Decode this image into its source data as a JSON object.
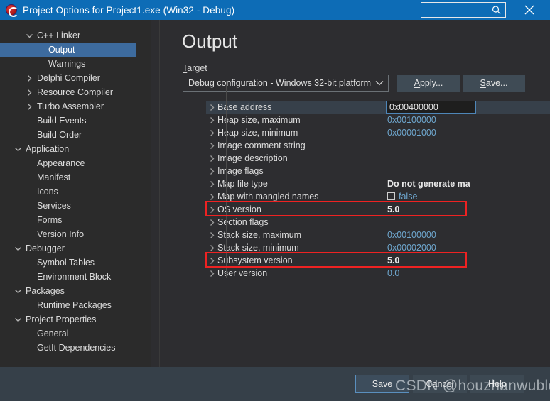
{
  "window": {
    "title": "Project Options for Project1.exe  (Win32 - Debug)",
    "app_icon": "embarcadero-logo-icon",
    "search_placeholder": "",
    "search_value": "",
    "search_icon": "search-icon",
    "close_icon": "close-icon"
  },
  "sidebar": {
    "items": [
      {
        "label": "",
        "depth": 1,
        "twisty": "none",
        "selected": false,
        "partial": true
      },
      {
        "label": "C++ Linker",
        "depth": 1,
        "twisty": "expanded",
        "selected": false
      },
      {
        "label": "Output",
        "depth": 2,
        "twisty": "none",
        "selected": true
      },
      {
        "label": "Warnings",
        "depth": 2,
        "twisty": "none",
        "selected": false
      },
      {
        "label": "Delphi Compiler",
        "depth": 1,
        "twisty": "collapsed",
        "selected": false
      },
      {
        "label": "Resource Compiler",
        "depth": 1,
        "twisty": "collapsed",
        "selected": false
      },
      {
        "label": "Turbo Assembler",
        "depth": 1,
        "twisty": "collapsed",
        "selected": false
      },
      {
        "label": "Build Events",
        "depth": 1,
        "twisty": "none",
        "selected": false
      },
      {
        "label": "Build Order",
        "depth": 1,
        "twisty": "none",
        "selected": false
      },
      {
        "label": "Application",
        "depth": 0,
        "twisty": "expanded",
        "selected": false
      },
      {
        "label": "Appearance",
        "depth": 1,
        "twisty": "none",
        "selected": false
      },
      {
        "label": "Manifest",
        "depth": 1,
        "twisty": "none",
        "selected": false
      },
      {
        "label": "Icons",
        "depth": 1,
        "twisty": "none",
        "selected": false
      },
      {
        "label": "Services",
        "depth": 1,
        "twisty": "none",
        "selected": false
      },
      {
        "label": "Forms",
        "depth": 1,
        "twisty": "none",
        "selected": false
      },
      {
        "label": "Version Info",
        "depth": 1,
        "twisty": "none",
        "selected": false
      },
      {
        "label": "Debugger",
        "depth": 0,
        "twisty": "expanded",
        "selected": false
      },
      {
        "label": "Symbol Tables",
        "depth": 1,
        "twisty": "none",
        "selected": false
      },
      {
        "label": "Environment Block",
        "depth": 1,
        "twisty": "none",
        "selected": false
      },
      {
        "label": "Packages",
        "depth": 0,
        "twisty": "expanded",
        "selected": false
      },
      {
        "label": "Runtime Packages",
        "depth": 1,
        "twisty": "none",
        "selected": false
      },
      {
        "label": "Project Properties",
        "depth": 0,
        "twisty": "expanded",
        "selected": false
      },
      {
        "label": "General",
        "depth": 1,
        "twisty": "none",
        "selected": false
      },
      {
        "label": "GetIt Dependencies",
        "depth": 1,
        "twisty": "none",
        "selected": false
      }
    ],
    "scroll_up_icon": "chevron-up-icon",
    "scroll_down_icon": "chevron-down-icon"
  },
  "main": {
    "page_title": "Output",
    "target_label": "Target",
    "target_label_accel": "T",
    "target_value": "Debug configuration - Windows 32-bit platform",
    "apply_label": "Apply...",
    "apply_accel": "A",
    "save_label": "Save...",
    "save_accel": "S",
    "dropdown_icon": "chevron-down-icon"
  },
  "properties": {
    "rows": [
      {
        "name": "Base address",
        "value": "0x00400000",
        "style": "editing",
        "selected": true,
        "highlight": false
      },
      {
        "name": "Heap size, maximum",
        "value": "0x00100000",
        "style": "link",
        "selected": false,
        "highlight": false
      },
      {
        "name": "Heap size, minimum",
        "value": "0x00001000",
        "style": "link",
        "selected": false,
        "highlight": false
      },
      {
        "name": "Image comment string",
        "value": "",
        "style": "link",
        "selected": false,
        "highlight": false
      },
      {
        "name": "Image description",
        "value": "",
        "style": "link",
        "selected": false,
        "highlight": false
      },
      {
        "name": "Image flags",
        "value": "",
        "style": "link",
        "selected": false,
        "highlight": false
      },
      {
        "name": "Map file type",
        "value": "Do not generate ma",
        "style": "bold",
        "selected": false,
        "highlight": false
      },
      {
        "name": "Map with mangled names",
        "value": "false",
        "style": "checkbox",
        "selected": false,
        "highlight": false
      },
      {
        "name": "OS version",
        "value": "5.0",
        "style": "bold",
        "selected": false,
        "highlight": true
      },
      {
        "name": "Section flags",
        "value": "",
        "style": "link",
        "selected": false,
        "highlight": false
      },
      {
        "name": "Stack size, maximum",
        "value": "0x00100000",
        "style": "link",
        "selected": false,
        "highlight": false
      },
      {
        "name": "Stack size, minimum",
        "value": "0x00002000",
        "style": "link",
        "selected": false,
        "highlight": false
      },
      {
        "name": "Subsystem version",
        "value": "5.0",
        "style": "bold",
        "selected": false,
        "highlight": true
      },
      {
        "name": "User version",
        "value": "0.0",
        "style": "link",
        "selected": false,
        "highlight": false
      }
    ],
    "expander_icon": "chevron-right-icon"
  },
  "footer": {
    "save_label": "Save",
    "cancel_label": "Cancel",
    "help_label": "Help"
  },
  "watermark": "CSDN @houzhanwublog",
  "colors": {
    "titlebar": "#0d6cb6",
    "selection": "#3d6b9e",
    "panel_bg": "#2d2d30",
    "sidebar_bg": "#2b2b2b",
    "footer_bg": "#364049",
    "highlight_red": "#ee2222",
    "value_blue": "#6fa8d0"
  }
}
